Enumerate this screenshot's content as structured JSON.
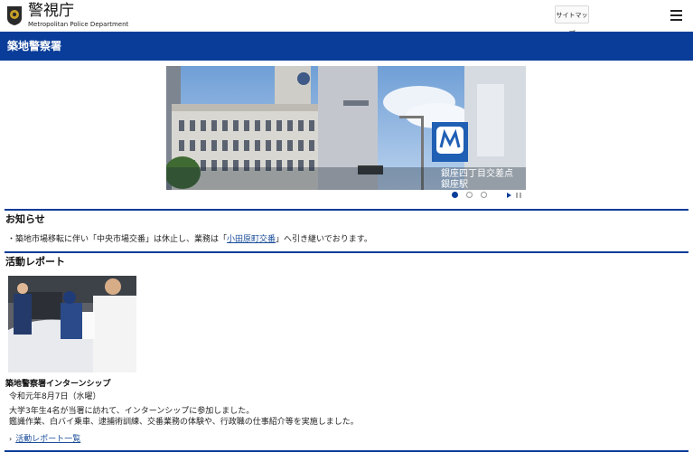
{
  "header": {
    "title_ja": "警視庁",
    "title_en": "Metropolitan Police Department",
    "sitemap_label": "サイトマップ"
  },
  "station": {
    "name": "築地警察署"
  },
  "carousel": {
    "slide_text_1": "銀座四丁目交差点",
    "slide_text_2": "銀座駅",
    "dot_count": 3,
    "active_dot": 1
  },
  "notice": {
    "heading": "お知らせ",
    "bullet": "・",
    "text_before": "築地市場移転に伴い「中央市場交番」は休止し、業務は「",
    "link_text": "小田原町交番",
    "text_after": "」へ引き継いでおります。"
  },
  "activity": {
    "heading": "活動レポート",
    "item_title": "築地警察署インターンシップ",
    "item_date": "令和元年8月7日（水曜）",
    "item_body_line1": "大学3年生4名が当署に訪れて、インターンシップに参加しました。",
    "item_body_line2": "鑑識作業、白バイ乗車、逮捕術訓練、交番業務の体験や、行政職の仕事紹介等を実施しました。",
    "more_link": "活動レポート一覧"
  },
  "colors": {
    "brand_blue": "#0a3d99",
    "link": "#1a4d99"
  }
}
